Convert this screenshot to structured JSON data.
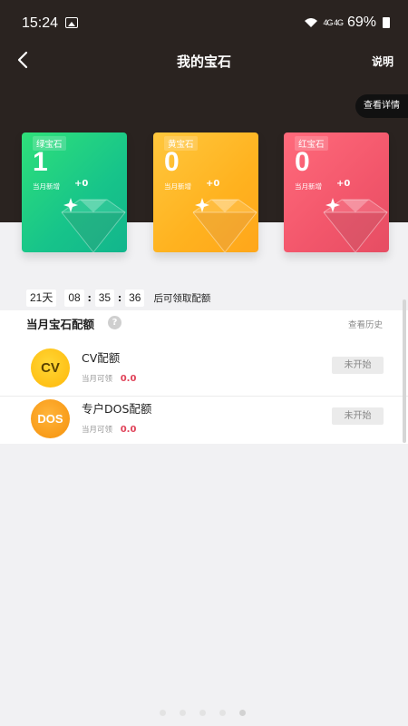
{
  "status_bar": {
    "time": "15:24",
    "network": "4G 4G",
    "battery": "69%"
  },
  "nav": {
    "title": "我的宝石",
    "right_link": "说明"
  },
  "detail_button": "查看详情",
  "gems": [
    {
      "name": "绿宝石",
      "count": "1",
      "new_label": "当月新增",
      "new_value": "+0",
      "color": "#1fcf82"
    },
    {
      "name": "黄宝石",
      "count": "0",
      "new_label": "当月新增",
      "new_value": "+0",
      "color": "#ffb522"
    },
    {
      "name": "红宝石",
      "count": "0",
      "new_label": "当月新增",
      "new_value": "+0",
      "color": "#f2566b"
    }
  ],
  "timer": {
    "days": "21天",
    "hours": "08",
    "minutes": "35",
    "seconds": "36",
    "suffix": "后可领取配额"
  },
  "quota_section": {
    "title": "当月宝石配额",
    "history_link": "查看历史",
    "items": [
      {
        "badge": "CV",
        "title": "CV配额",
        "sub_label": "当月可领",
        "value": "0.0",
        "status": "未开始"
      },
      {
        "badge": "DOS",
        "title": "专户DOS配额",
        "sub_label": "当月可领",
        "value": "0.0",
        "status": "未开始"
      }
    ]
  },
  "colors": {
    "header_bg": "#2a2320",
    "accent_red": "#e0445a",
    "page_bg": "#f1f1f3"
  }
}
